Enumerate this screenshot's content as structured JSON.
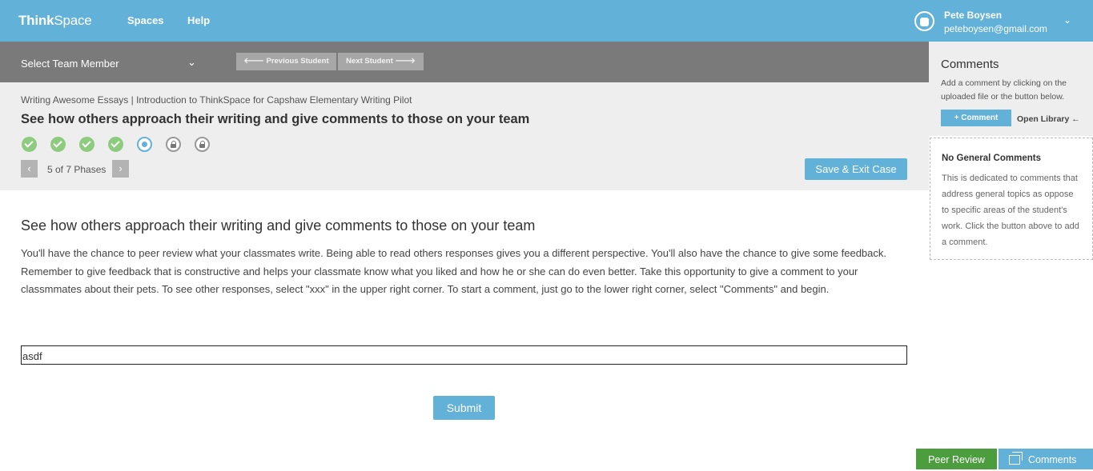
{
  "header": {
    "logo_bold": "Think",
    "logo_light": "Space",
    "nav": [
      "Spaces",
      "Help"
    ],
    "user_name": "Pete Boysen",
    "user_email": "peteboysen@gmail.com",
    "chevron": "⌄"
  },
  "team_bar": {
    "select_label": "Select Team Member",
    "chevron": "⌄",
    "prev_label": "🡐 Previous Student",
    "next_label": "Next Student 🡒"
  },
  "phase": {
    "breadcrumb_space": "Writing Awesome Essays",
    "breadcrumb_separator": "|",
    "breadcrumb_case": "Introduction to ThinkSpace for Capshaw Elementary Writing Pilot",
    "title": "See how others approach their writing and give comments to those on your team",
    "steps": [
      "done",
      "done",
      "done",
      "done",
      "current",
      "locked",
      "locked"
    ],
    "pager_prev": "‹",
    "pager_next": "›",
    "pager_text": "5 of 7 Phases",
    "save_exit_label": "Save & Exit Case"
  },
  "content": {
    "title": "See how others approach their writing and give comments to those on your team",
    "body": "You'll have the chance to peer review what your classmates write. Being able to read others responses gives you a different perspective. You'll also have the chance to give some feedback. Remember to give feedback that is constructive and helps your classmate know what you liked and how he or she can do even better. Take this opportunity to give a comment to your classmmates about their pets. To see other responses, select \"xxx\" in the upper right corner. To start a comment, just go to the lower right corner, select \"Comments\" and begin.",
    "answer_value": "asdf",
    "submit_label": "Submit"
  },
  "sidebar": {
    "title": "Comments",
    "help": "Add a comment by clicking on the uploaded file or the button below.",
    "comment_button": "+  Comment",
    "open_library": "Open Library  ←",
    "general_title": "No General Comments",
    "general_text": "This is dedicated to comments that address general topics as oppose to specific areas of the student's work. Click the button above to add a comment."
  },
  "bottom_tabs": {
    "peer_review": "Peer Review",
    "comments": "Comments"
  },
  "colors": {
    "accent": "#62b1d9",
    "peer_review": "#4c9d3e",
    "team_bar": "#7a7a7a",
    "done_step": "#8dcb7e"
  }
}
